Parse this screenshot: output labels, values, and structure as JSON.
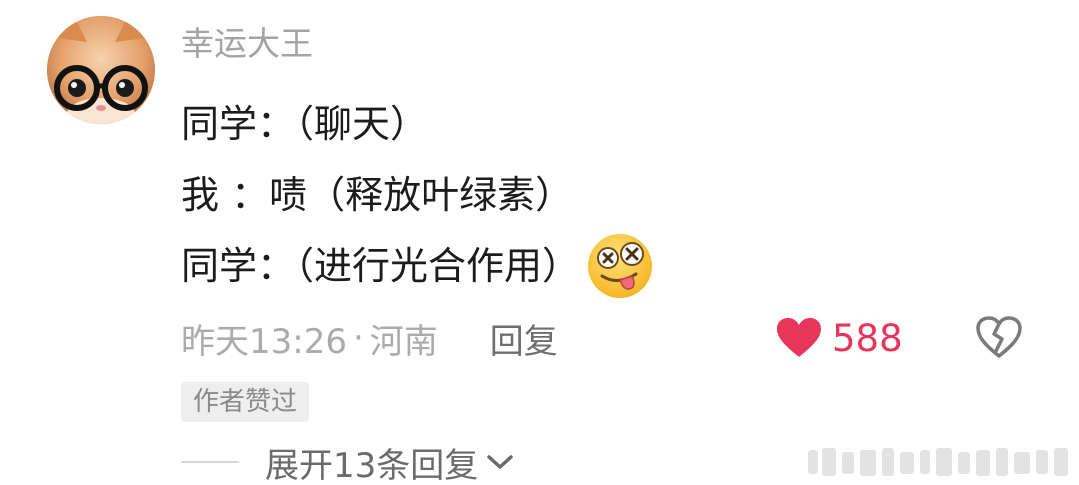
{
  "comment": {
    "username": "幸运大王",
    "lines": [
      "同学：（聊天）",
      "我 ：啧（释放叶绿素）",
      "同学：（进行光合作用）"
    ],
    "avatar_icon": "cat-with-glasses-avatar",
    "emoji_icon": "dizzy-tongue-out-emoji",
    "timestamp": "昨天13:26",
    "separator": "·",
    "location": "河南",
    "reply_label": "回复",
    "like_icon": "heart-icon",
    "like_color": "#e8365a",
    "like_count": "588",
    "dislike_icon": "broken-heart-icon",
    "author_badge": "作者赞过",
    "expand_label": "展开13条回复",
    "expand_icon": "chevron-down-icon"
  }
}
